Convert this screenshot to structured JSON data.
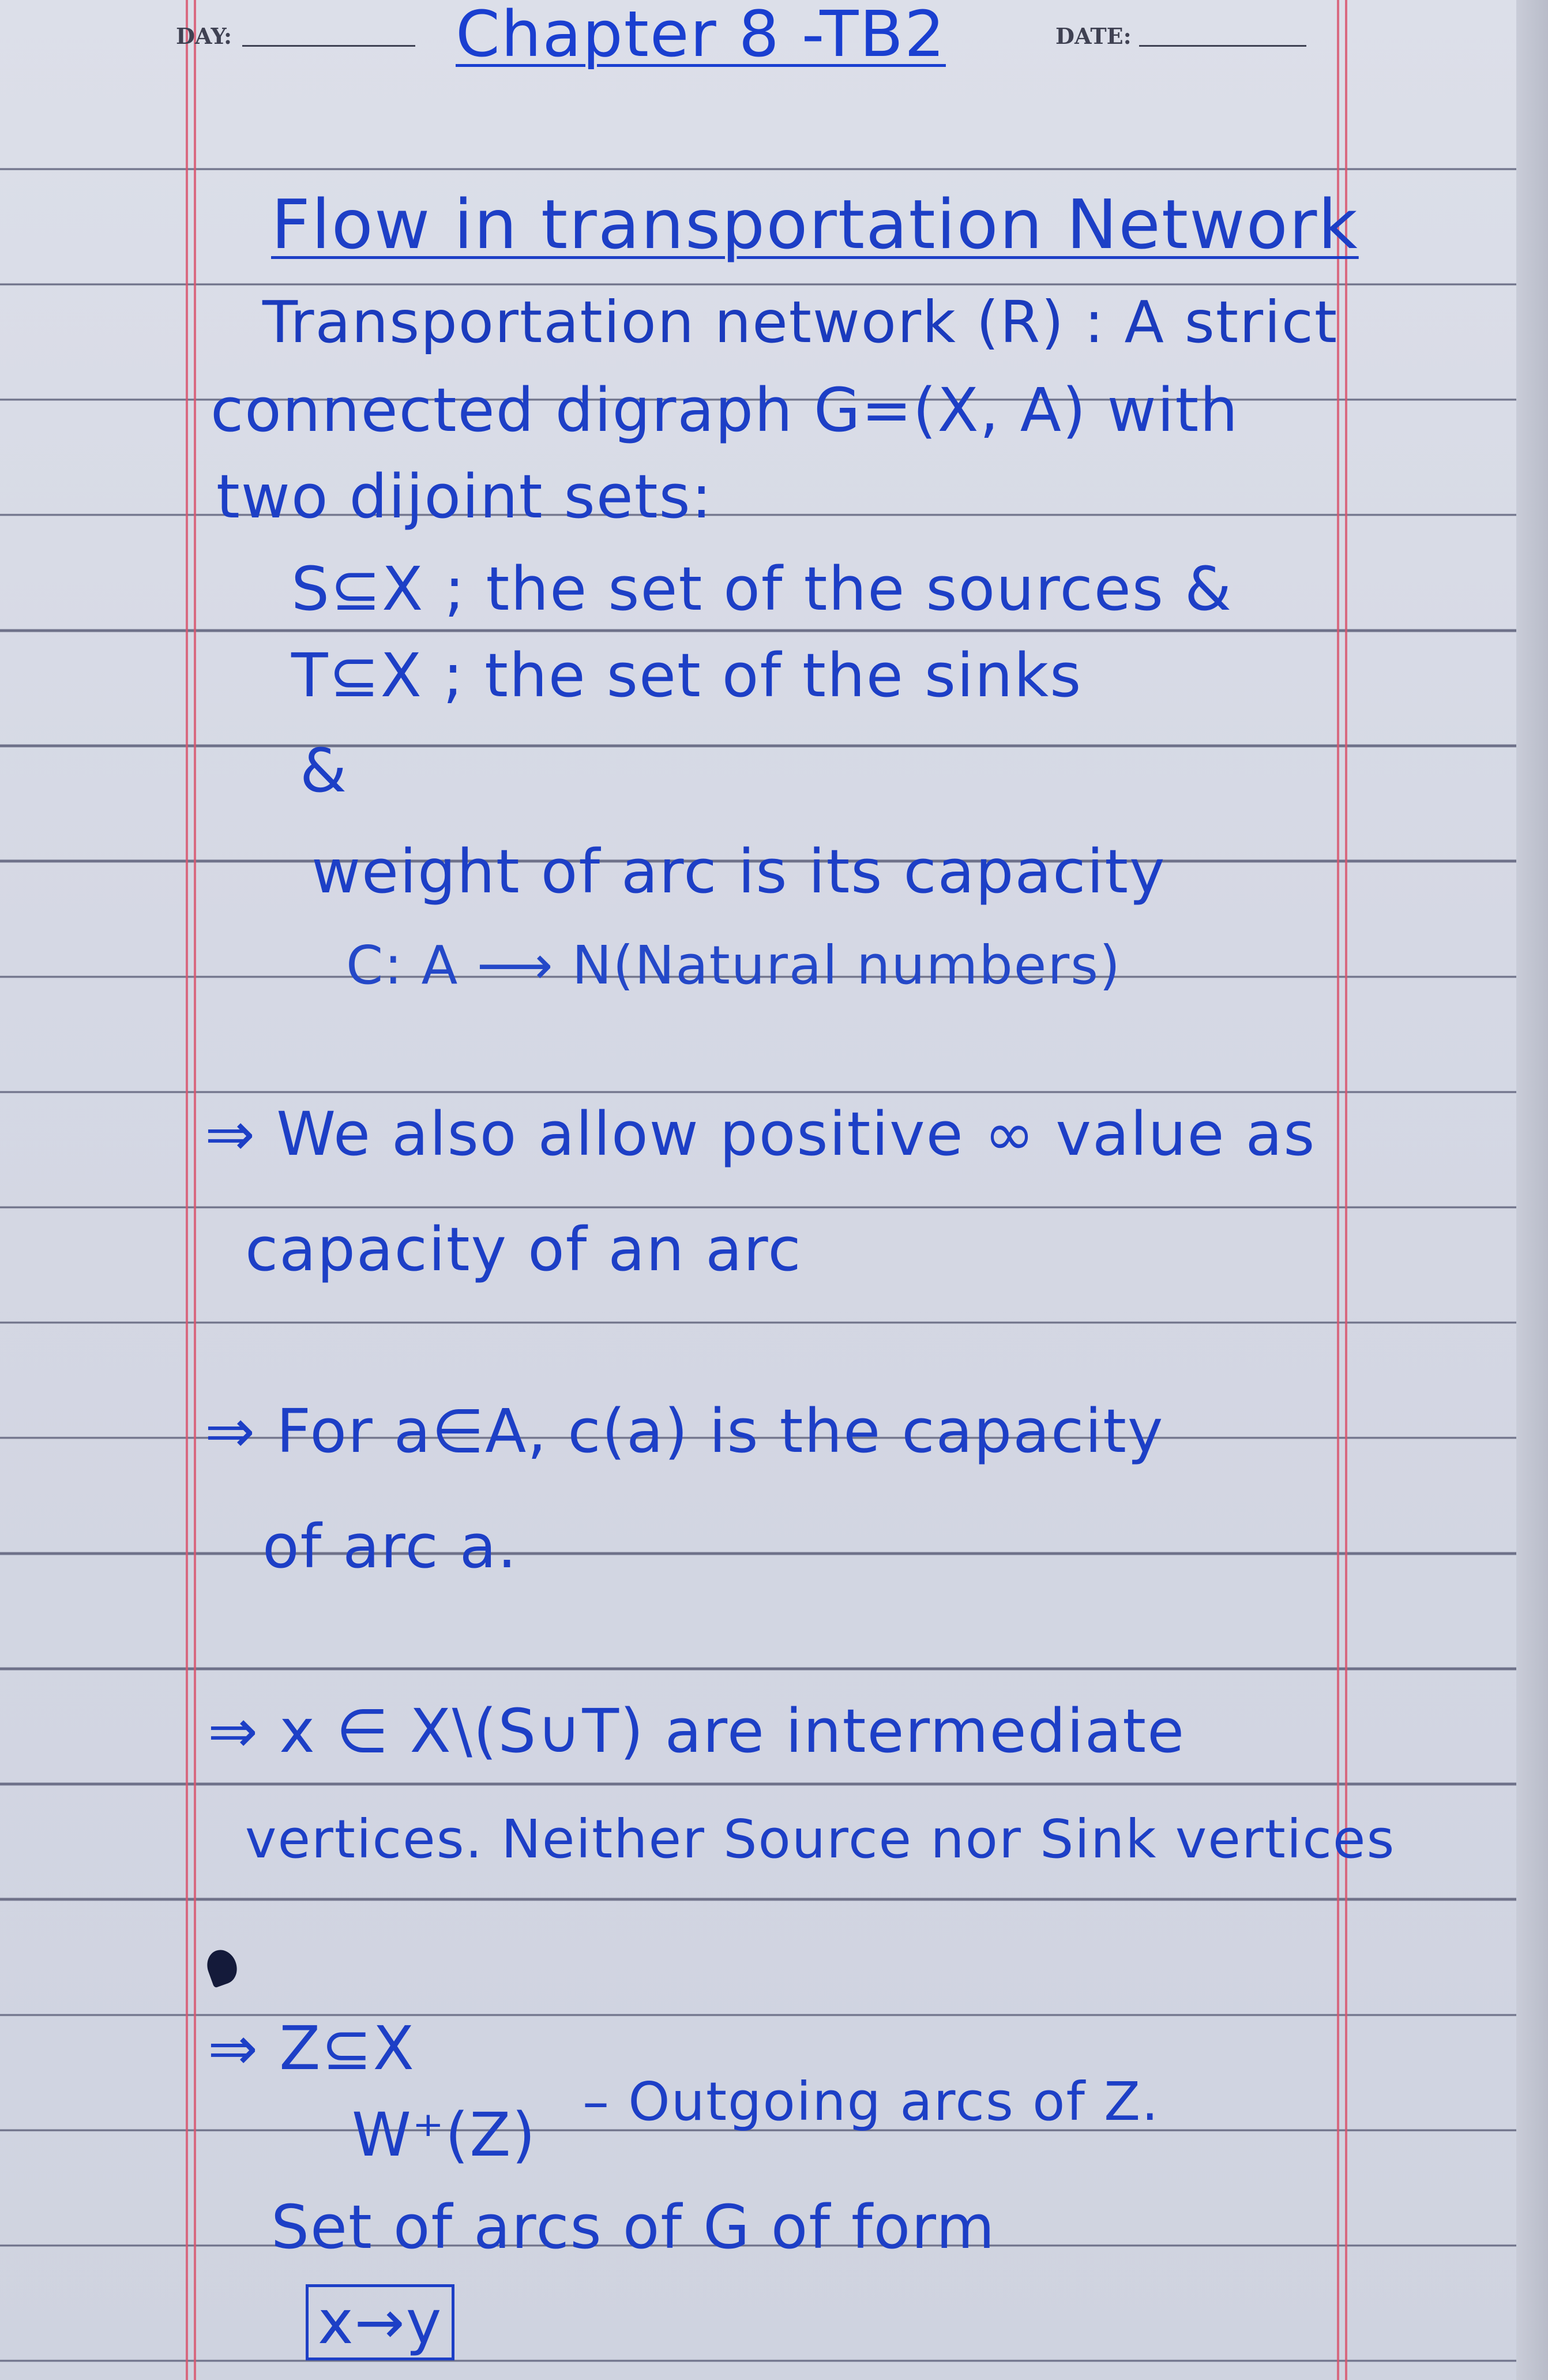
{
  "header": {
    "day_label": "DAY:",
    "date_label": "DATE:",
    "chapter_title": "Chapter 8 -TB2"
  },
  "notes": {
    "heading": "Flow in transportation Network",
    "definition": {
      "line1": "Transportation network (R) : A strict",
      "line2": "connected digraph G=(X, A) with",
      "line3": "two dijoint sets:",
      "sources": "S⊆X ; the set of the sources &",
      "sinks": "T⊆X ; the set of the sinks",
      "and": "&",
      "weight": "weight of arc is its capacity",
      "capacity_map": "C: A ⟶ N(Natural numbers)"
    },
    "point1": {
      "line1": "⇒ We also allow positive ∞ value as",
      "line2": "capacity of an arc"
    },
    "point2": {
      "line1": "⇒ For a∈A, c(a) is the capacity",
      "line2": "of arc a."
    },
    "point3": {
      "line1": "⇒ x ∈ X\\(S∪T) are intermediate",
      "line2": "vertices. Neither Source nor Sink vertices"
    },
    "point4": {
      "line1": "⇒ Z⊆X",
      "line2_symbol": "W⁺(Z)",
      "line2_text": "– Outgoing arcs of Z.",
      "line3": "Set of arcs of G of form",
      "boxed": "x→y"
    }
  },
  "colors": {
    "ink": "#1d3fc6",
    "margin_red": "#d8566e",
    "rule_line": "#6d7088"
  }
}
